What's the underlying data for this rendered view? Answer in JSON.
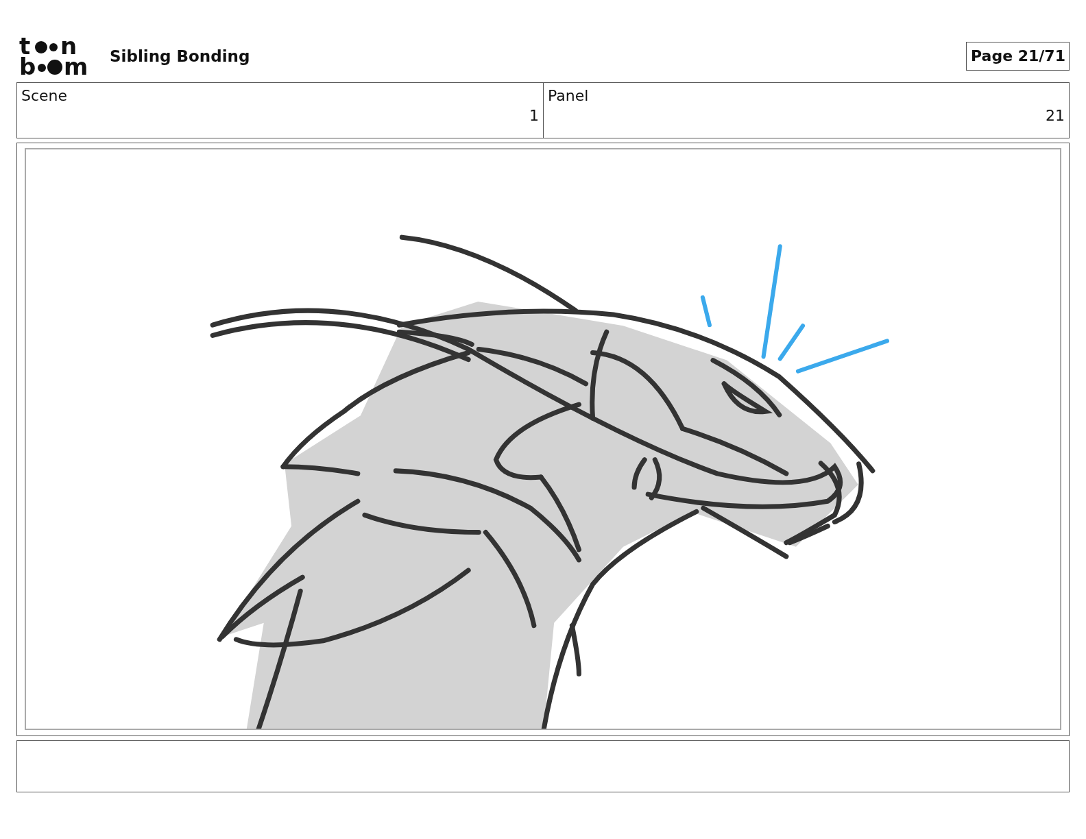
{
  "logo": {
    "letters": [
      "t",
      "n",
      "b",
      "m"
    ]
  },
  "title": "Sibling Bonding",
  "page_label": "Page 21/71",
  "info_table": {
    "columns": [
      "Scene",
      "Panel"
    ],
    "rows": [
      [
        "1",
        "21"
      ]
    ]
  }
}
